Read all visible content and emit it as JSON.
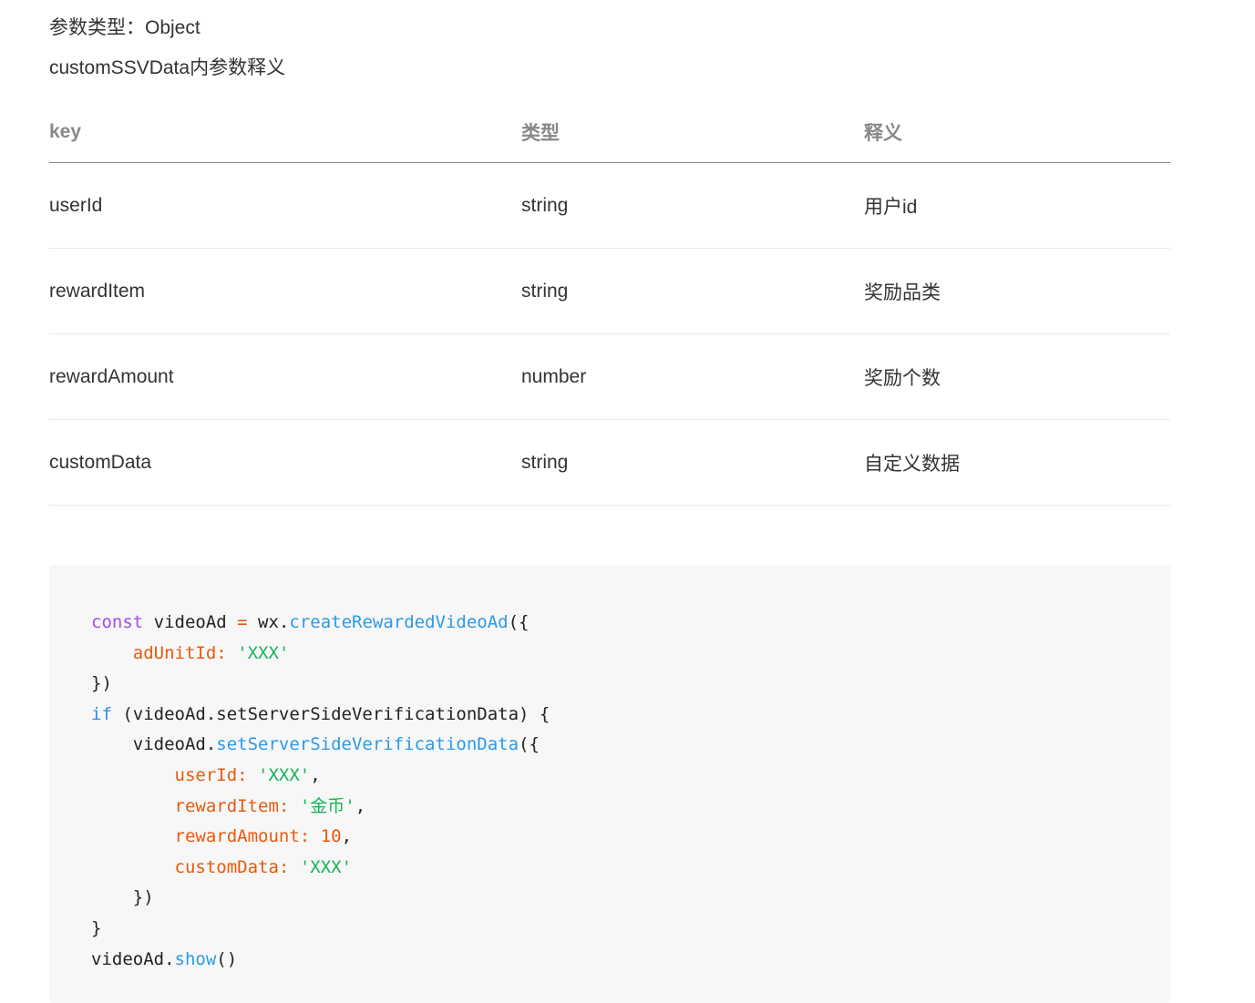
{
  "doc": {
    "param_type_line": "参数类型：Object",
    "param_desc_title": "customSSVData内参数释义"
  },
  "table": {
    "headers": [
      "key",
      "类型",
      "释义"
    ],
    "rows": [
      {
        "key": "userId",
        "type": "string",
        "desc": "用户id"
      },
      {
        "key": "rewardItem",
        "type": "string",
        "desc": "奖励品类"
      },
      {
        "key": "rewardAmount",
        "type": "number",
        "desc": "奖励个数"
      },
      {
        "key": "customData",
        "type": "string",
        "desc": "自定义数据"
      }
    ]
  },
  "code": {
    "const_kw": "const",
    "var_name": " videoAd ",
    "eq": "=",
    "wx": " wx.",
    "create_fn": "createRewardedVideoAd",
    "open1": "({",
    "adunit_key": "adUnitId:",
    "adunit_val": "'XXX'",
    "close1": "})",
    "if_kw": "if",
    "if_cond": " (videoAd.setServerSideVerificationData) {",
    "call_obj": "videoAd.",
    "set_fn": "setServerSideVerificationData",
    "open2": "({",
    "userid_key": "userId:",
    "userid_val": "'XXX'",
    "rewarditem_key": "rewardItem:",
    "rewarditem_val": "'金币'",
    "rewardamount_key": "rewardAmount:",
    "rewardamount_val": "10",
    "customdata_key": "customData:",
    "customdata_val": "'XXX'",
    "close2": "})",
    "close_brace": "}",
    "show_obj": "videoAd.",
    "show_fn": "show",
    "show_paren": "()",
    "comma": ","
  }
}
